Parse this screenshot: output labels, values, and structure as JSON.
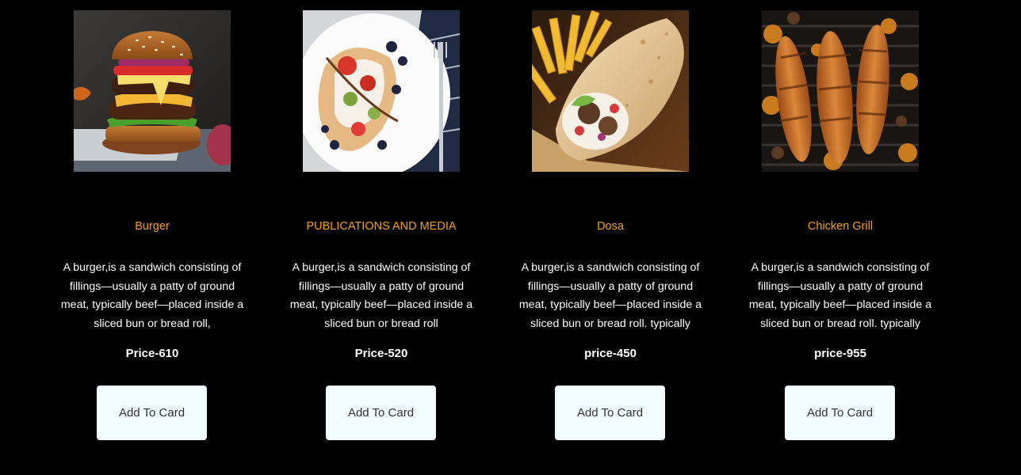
{
  "products": [
    {
      "name": "Burger",
      "description_lines": [
        "A burger,is a sandwich consisting of",
        "fillings—usually a patty of ground",
        "meat, typically beef—placed inside a",
        "sliced bun or bread roll,"
      ],
      "price": "Price-610",
      "button_label": "Add To Card"
    },
    {
      "name": "PUBLICATIONS AND MEDIA",
      "description_lines": [
        "A burger,is a sandwich consisting of",
        "fillings—usually a patty of ground",
        "meat, typically beef—placed inside a",
        "sliced bun or bread roll"
      ],
      "price": "Price-520",
      "button_label": "Add To Card"
    },
    {
      "name": "Dosa",
      "description_lines": [
        "A burger,is a sandwich consisting of",
        "fillings—usually a patty of ground",
        "meat, typically beef—placed inside a",
        "sliced bun or bread roll. typically"
      ],
      "price": "price-450",
      "button_label": "Add To Card"
    },
    {
      "name": "Chicken Grill",
      "description_lines": [
        "A burger,is a sandwich consisting of",
        "fillings—usually a patty of ground",
        "meat, typically beef—placed inside a",
        "sliced bun or bread roll. typically"
      ],
      "price": "price-955",
      "button_label": "Add To Card"
    }
  ],
  "colors": {
    "background": "#000000",
    "title_accent": "#f5a20e",
    "text": "#ffffff",
    "button_bg": "#f0fcfd",
    "button_text": "#333333"
  }
}
